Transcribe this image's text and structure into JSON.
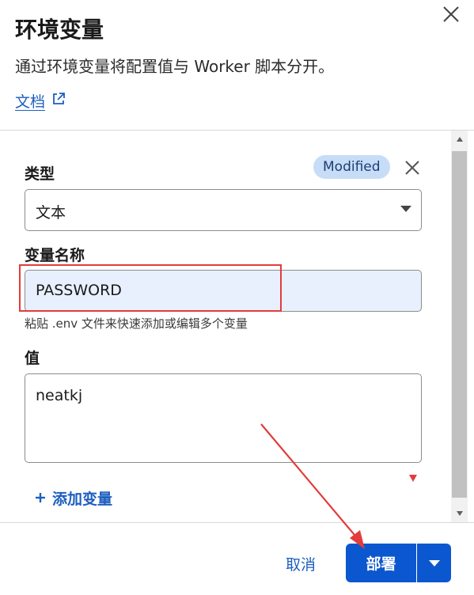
{
  "header": {
    "title": "环境变量",
    "subtitle": "通过环境变量将配置值与 Worker 脚本分开。",
    "doc_link": "文档"
  },
  "form": {
    "type_label": "类型",
    "status_badge": "Modified",
    "type_value": "文本",
    "name_label": "变量名称",
    "name_value": "PASSWORD",
    "name_hint": "粘贴 .env 文件来快速添加或编辑多个变量",
    "value_label": "值",
    "value_text": "neatkj",
    "add_variable": "添加变量"
  },
  "footer": {
    "cancel_label": "取消",
    "deploy_label": "部署"
  },
  "colors": {
    "accent": "#0b57d0",
    "link": "#1d5fbf",
    "annotation": "#e23c3c",
    "badge_bg": "#c7dcf7"
  },
  "icons": [
    "close-icon",
    "external-link-icon",
    "remove-icon",
    "chevron-down-icon",
    "plus-icon",
    "scroll-up-icon",
    "scroll-down-icon"
  ]
}
